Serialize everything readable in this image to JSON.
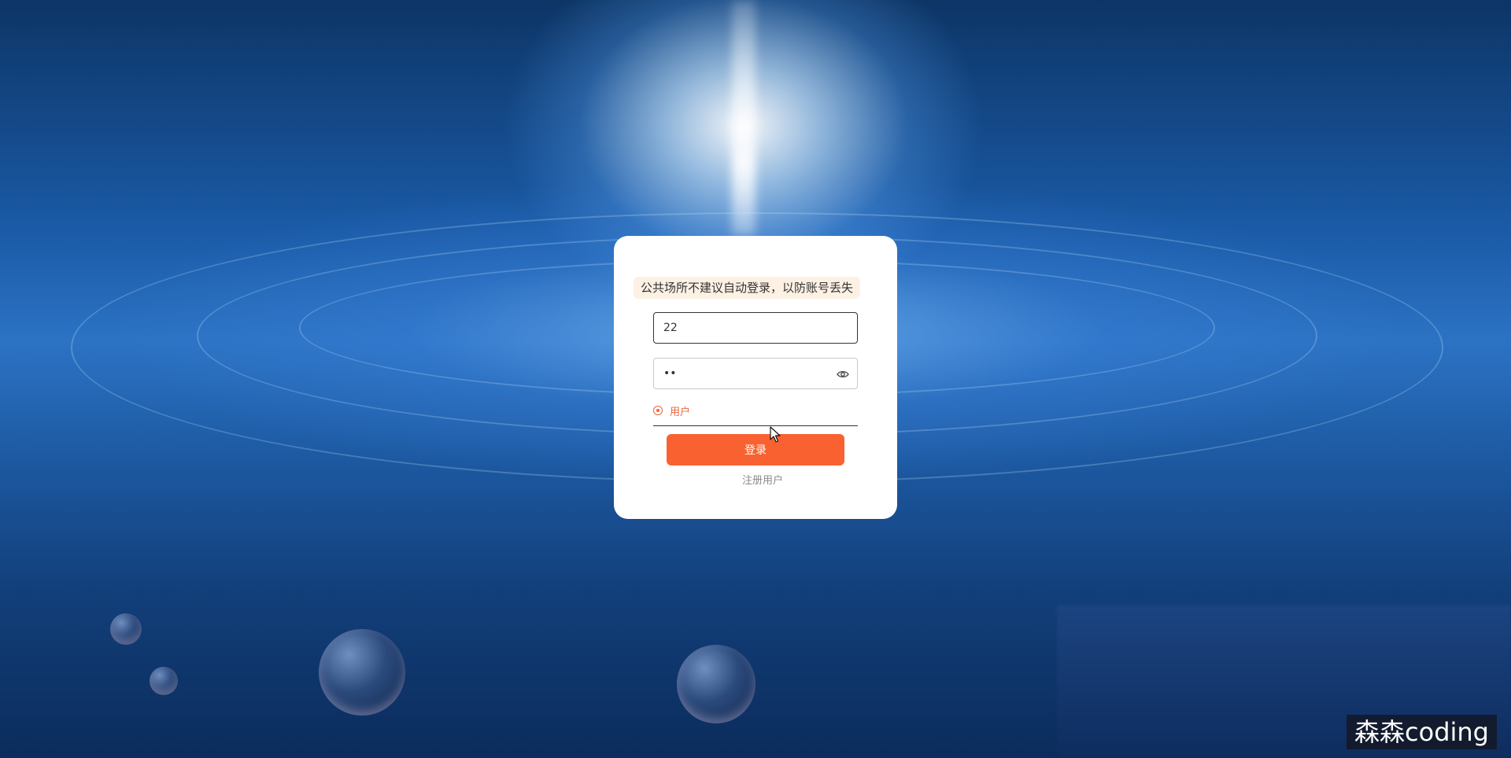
{
  "login_form": {
    "notice": "公共场所不建议自动登录，以防账号丢失",
    "username_value": "22",
    "password_value": "22",
    "role_option_label": "用户",
    "login_button_label": "登录",
    "register_link_label": "注册用户"
  },
  "watermark": {
    "text": "森森coding"
  },
  "icons": {
    "password_toggle": "eye-icon",
    "role_radio": "radio-selected-icon",
    "pointer": "mouse-cursor-icon"
  },
  "colors": {
    "accent": "#f96230",
    "notice_background": "#fdf1e4",
    "card_background": "#ffffff"
  }
}
